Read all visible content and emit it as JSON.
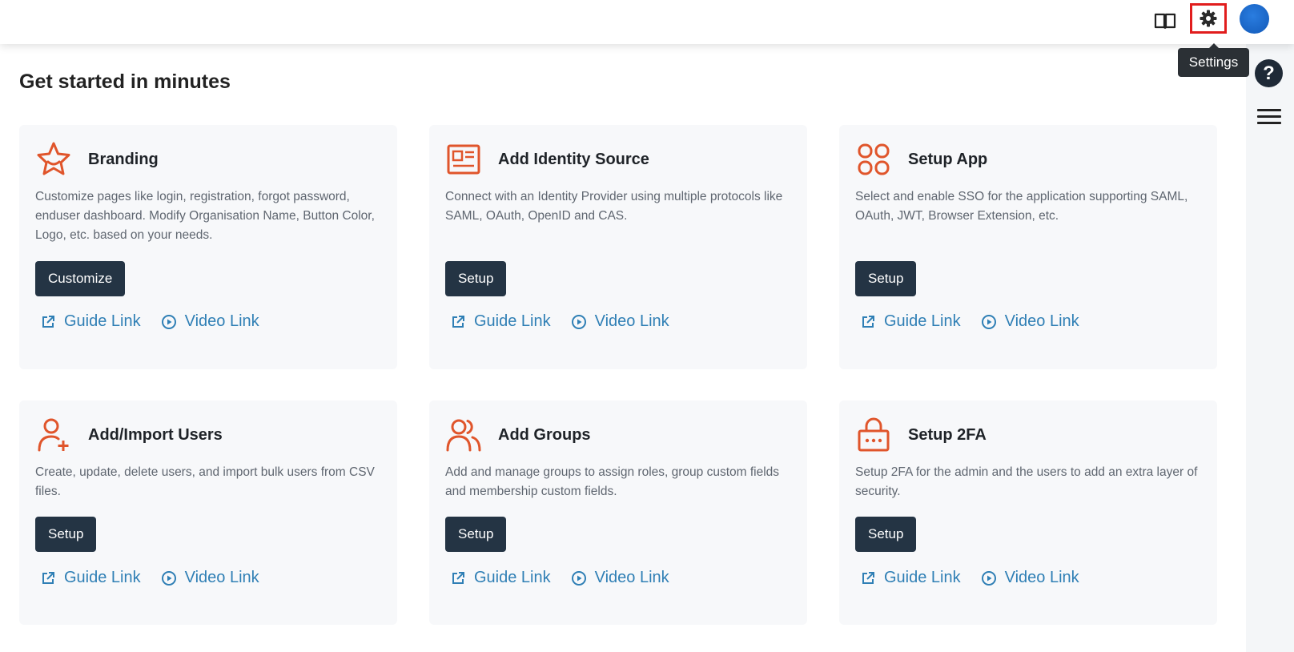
{
  "header": {
    "icons": {
      "docs": "book-icon",
      "settings": "gear-icon",
      "avatar": "user-avatar"
    },
    "tooltip": "Settings"
  },
  "sidebar": {
    "help": "?",
    "icons": {
      "help": "question-icon",
      "menu": "hamburger-menu-icon"
    }
  },
  "page": {
    "title": "Get started in minutes"
  },
  "colors": {
    "accent": "#e0552b",
    "button": "#243444",
    "link": "#2f7fb5",
    "card_bg": "#f7f8fa"
  },
  "cards": [
    {
      "title": "Branding",
      "icon": "smile-star-icon",
      "description": "Customize pages like login, registration, forgot password, enduser dashboard. Modify Organisation Name, Button Color, Logo, etc. based on your needs.",
      "button": "Customize",
      "guide": "Guide Link",
      "video": "Video Link"
    },
    {
      "title": "Add Identity Source",
      "icon": "id-card-icon",
      "description": "Connect with an Identity Provider using multiple protocols like SAML, OAuth, OpenID and CAS.",
      "button": "Setup",
      "guide": "Guide Link",
      "video": "Video Link"
    },
    {
      "title": "Setup App",
      "icon": "apps-grid-icon",
      "description": "Select and enable SSO for the application supporting SAML, OAuth, JWT, Browser Extension, etc.",
      "button": "Setup",
      "guide": "Guide Link",
      "video": "Video Link"
    },
    {
      "title": "Add/Import Users",
      "icon": "user-add-icon",
      "description": "Create, update, delete users, and import bulk users from CSV files.",
      "button": "Setup",
      "guide": "Guide Link",
      "video": "Video Link"
    },
    {
      "title": "Add Groups",
      "icon": "users-group-icon",
      "description": "Add and manage groups to assign roles, group custom fields and membership custom fields.",
      "button": "Setup",
      "guide": "Guide Link",
      "video": "Video Link"
    },
    {
      "title": "Setup 2FA",
      "icon": "lock-icon",
      "description": "Setup 2FA for the admin and the users to add an extra layer of security.",
      "button": "Setup",
      "guide": "Guide Link",
      "video": "Video Link"
    }
  ]
}
